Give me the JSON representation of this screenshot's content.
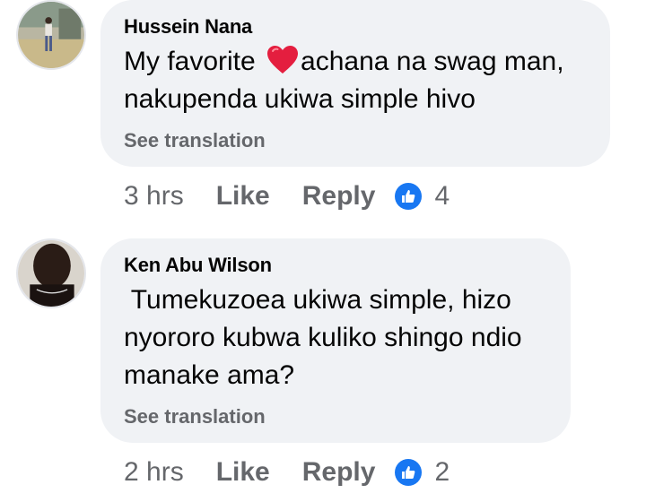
{
  "comments": [
    {
      "author": "Hussein Nana",
      "text_before": "My favorite ",
      "text_after": "achana na swag man,",
      "text_line2": "nakupenda ukiwa simple hivo",
      "see_translation": "See translation",
      "time": "3 hrs",
      "like_label": "Like",
      "reply_label": "Reply",
      "reaction_count": "4",
      "emoji": "red-heart"
    },
    {
      "author": "Ken Abu Wilson",
      "text_line1": " Tumekuzoea ukiwa simple, hizo",
      "text_line2": "nyororo kubwa kuliko shingo ndio",
      "text_line3": "manake ama?",
      "see_translation": "See translation",
      "time": "2 hrs",
      "like_label": "Like",
      "reply_label": "Reply",
      "reaction_count": "2"
    }
  ],
  "colors": {
    "bubble": "#f0f2f5",
    "secondary_text": "#65676b",
    "like_blue": "#1877f2",
    "heart_red": "#e41e3f"
  }
}
